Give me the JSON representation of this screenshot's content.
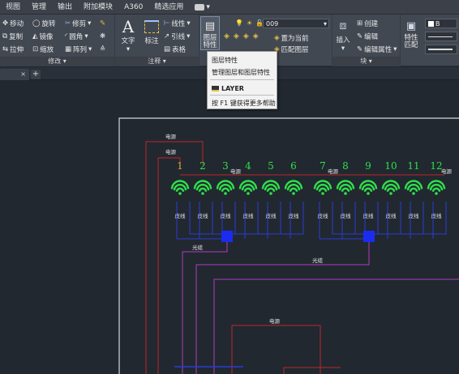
{
  "menubar": {
    "items": [
      "视图",
      "管理",
      "输出",
      "附加模块",
      "A360",
      "精选应用"
    ]
  },
  "ribbon": {
    "modify": {
      "title": "修改 ▾",
      "move": "移动",
      "rotate": "旋转",
      "trim": "修剪",
      "copy": "复制",
      "mirror": "镜像",
      "fillet": "圆角",
      "stretch": "拉伸",
      "scale": "缩放",
      "array": "阵列"
    },
    "annotation": {
      "title": "注释 ▾",
      "text": "文字",
      "dimension": "标注",
      "linear": "线性",
      "leader": "引线",
      "table": "表格"
    },
    "layers": {
      "properties": "图层\n特性",
      "layer_value": "009",
      "set_current": "置为当前",
      "match_layer": "匹配图层"
    },
    "block": {
      "title": "块 ▾",
      "insert": "插入",
      "create": "创建",
      "edit": "编辑",
      "edit_attributes": "编辑属性"
    },
    "properties": {
      "match": "特性\n匹配",
      "bylayer": "B"
    }
  },
  "tooltip": {
    "line1": "图层特性",
    "line2": "管理图层和图层特性",
    "command": "LAYER",
    "help": "按 F1 键获得更多帮助"
  },
  "drawing": {
    "ap_numbers": [
      "1",
      "2",
      "3",
      "4",
      "5",
      "6",
      "7",
      "8",
      "9",
      "10",
      "11",
      "12"
    ],
    "cable_label": "皮线",
    "power_label": "电源",
    "fiber_label": "光缆",
    "colors": {
      "wifi": "#2fe04a",
      "number_first": "#d9a93c",
      "number": "#2fe04a",
      "red": "#c0262a",
      "blue": "#2b3bd6",
      "magenta": "#b23dbd",
      "frame": "#d8d8d8"
    }
  }
}
